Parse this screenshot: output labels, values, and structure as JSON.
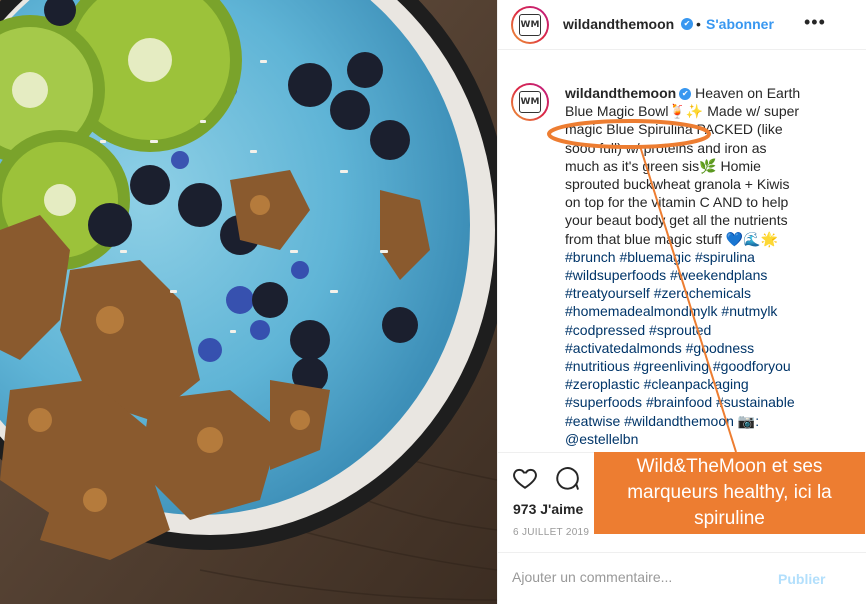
{
  "post": {
    "username": "wildandthemoon",
    "verified_glyph": "✔",
    "follow_separator": "•",
    "follow_label": "S'abonner",
    "more_glyph": "•••",
    "avatar_logo": "WM",
    "caption_lines": [
      {
        "prefix_user": "wildandthemoon",
        "text": " Heaven on Earth"
      },
      {
        "text": "Blue Magic Bowl🍹✨ Made w/ super"
      },
      {
        "text": "magic Blue Spirulina PACKED (like"
      },
      {
        "text": "sooo full) w/ proteins and iron as"
      },
      {
        "text": "much as it's green sis🌿 Homie"
      },
      {
        "text": "sprouted buckwheat granola + Kiwis"
      },
      {
        "text": "on top for the vitamin C AND to help"
      },
      {
        "text": "your beaut body get all the nutrients"
      },
      {
        "text": "from that blue magic stuff 💙🌊🌟"
      },
      {
        "text": "#brunch #bluemagic #spirulina",
        "tags": true
      },
      {
        "text": "#wildsuperfoods #weekendplans",
        "tags": true
      },
      {
        "text": "#treatyourself #zerochemicals",
        "tags": true
      },
      {
        "text": "#homemadealmondmylk #nutmylk",
        "tags": true
      },
      {
        "text": "#codpressed #sprouted",
        "tags": true
      },
      {
        "text": "#activatedalmonds #goodness",
        "tags": true
      },
      {
        "text": "#nutritious #greenliving #goodforyou",
        "tags": true
      },
      {
        "text": "#zeroplastic #cleanpackaging",
        "tags": true
      },
      {
        "text": "#superfoods #brainfood #sustainable",
        "tags": true
      },
      {
        "text": "#eatwise #wildandthemoon 📷:",
        "tags": true
      },
      {
        "text": "@estellelbn",
        "tags": true
      }
    ],
    "likes": "973 J'aime",
    "date": "6 JUILLET 2019"
  },
  "comment": {
    "placeholder": "Ajouter un commentaire...",
    "publish_label": "Publier"
  },
  "annotation": {
    "callout_text": "Wild&TheMoon et ses marqueurs healthy, ici la spiruline",
    "color": "#ed7d31"
  },
  "colors": {
    "link_blue": "#3897f0",
    "hashtag": "#003569",
    "publish_disabled": "#b2dffc"
  },
  "icons": [
    "heart-icon",
    "comment-icon",
    "more-options-icon",
    "verified-icon"
  ]
}
